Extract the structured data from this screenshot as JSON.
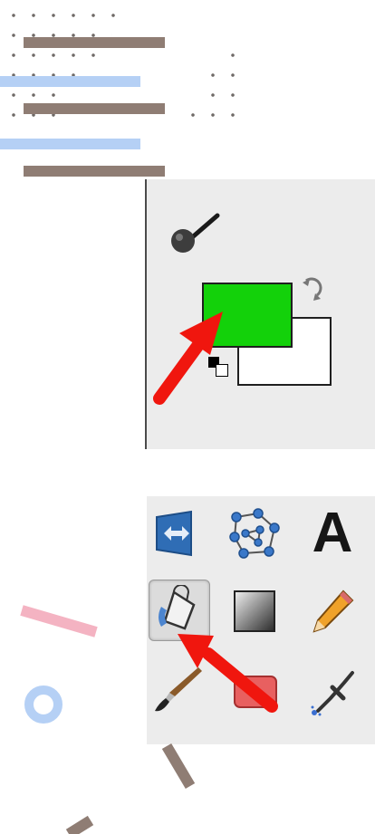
{
  "colors": {
    "foreground": "#13d10a",
    "background": "#ffffff",
    "arrow": "#f0160e",
    "panel": "#ececec",
    "deco_brown": "#8f7d74",
    "deco_blue": "#b5d0f5",
    "deco_pink": "#f4b3c2"
  },
  "color_panel": {
    "icons": [
      "brush-indicator-icon",
      "swap-colors-icon",
      "default-colors-icon"
    ]
  },
  "toolbox": {
    "tools": [
      {
        "name": "flip-tool",
        "icon": "flip-icon"
      },
      {
        "name": "cage-transform-tool",
        "icon": "cage-transform-icon"
      },
      {
        "name": "text-tool",
        "icon": "text-icon"
      },
      {
        "name": "bucket-fill-tool",
        "icon": "bucket-fill-icon",
        "active": true
      },
      {
        "name": "blend-tool",
        "icon": "gradient-icon"
      },
      {
        "name": "pencil-tool",
        "icon": "pencil-icon"
      },
      {
        "name": "paintbrush-tool",
        "icon": "paintbrush-icon"
      },
      {
        "name": "eraser-tool",
        "icon": "eraser-icon"
      },
      {
        "name": "airbrush-tool",
        "icon": "airbrush-icon"
      }
    ],
    "text_glyph": "A"
  }
}
